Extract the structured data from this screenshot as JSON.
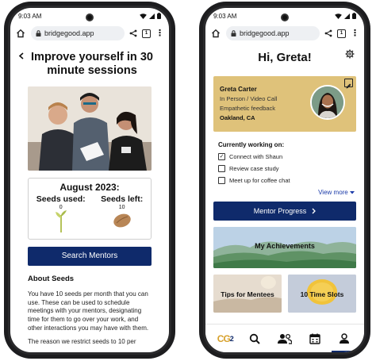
{
  "left_phone": {
    "status": {
      "time": "9:03 AM"
    },
    "browser": {
      "url": "bridgegood.app",
      "tab_count": "1"
    },
    "page": {
      "title": "Improve yourself in 30 minute sessions",
      "seeds": {
        "heading": "August 2023:",
        "used_label": "Seeds used:",
        "used_value": "0",
        "left_label": "Seeds left:",
        "left_value": "10"
      },
      "search_button": "Search Mentors",
      "about_heading": "About Seeds",
      "about_text": "You have 10 seeds per month that you can use. These can be used to schedule meetings with your mentors, designating time for them to go over your work, and other interactions you may have with them.",
      "about_text_2": "The reason we restrict seeds to 10 per"
    }
  },
  "right_phone": {
    "status": {
      "time": "9:03 AM"
    },
    "browser": {
      "url": "bridgegood.app",
      "tab_count": "1"
    },
    "page": {
      "greeting": "Hi, Greta!",
      "profile": {
        "name": "Greta Carter",
        "line1": "In Person / Video Call",
        "line2": "Empathetic feedback",
        "location": "Oakland, CA"
      },
      "working_heading": "Currently working on:",
      "tasks": [
        {
          "label": "Connect with Shaun",
          "checked": true
        },
        {
          "label": "Review case study",
          "checked": false
        },
        {
          "label": "Meet up for coffee chat",
          "checked": false
        }
      ],
      "view_more": "View more",
      "progress_button": "Mentor Progress",
      "achievements": "My Achievements",
      "tile_tips": "Tips for Mentees",
      "tile_slots": "10 Time Slots",
      "nav": {
        "logo": "CG",
        "logo_sub": "2"
      }
    }
  },
  "colors": {
    "primary": "#0f2a6b",
    "profile_card": "#dfc27a",
    "link": "#1a3aa8"
  },
  "icons": [
    "home-icon",
    "lock-icon",
    "share-icon",
    "tabs-icon",
    "menu-icon",
    "back-icon",
    "gear-icon",
    "edit-icon",
    "check-icon",
    "chevron-right-icon",
    "chevron-down-icon",
    "search-icon",
    "people-icon",
    "calendar-icon",
    "person-icon",
    "wifi-icon",
    "battery-icon"
  ]
}
